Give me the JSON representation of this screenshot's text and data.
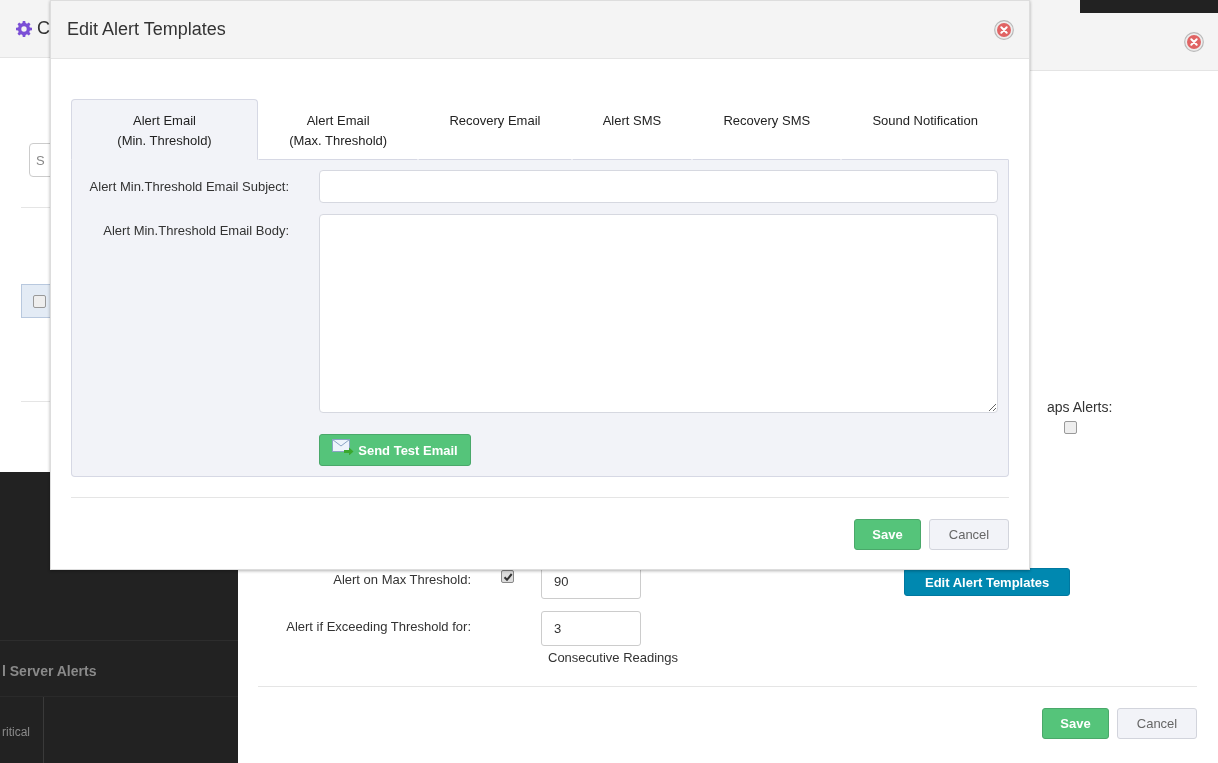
{
  "back_window": {
    "title": "C",
    "search": {
      "placeholder": "S"
    },
    "row": {
      "checked": false
    }
  },
  "back_page": {
    "heading": "l Server Alerts",
    "column_1": "ritical"
  },
  "settings_dialog": {
    "section": {
      "label": "aps Alerts:",
      "checked": false
    },
    "fields": [
      {
        "kind": "check-input",
        "label": "Alert on Max Threshold:",
        "checked": true,
        "value": "90"
      },
      {
        "kind": "input",
        "label": "Alert if Exceeding Threshold for:",
        "value": "3",
        "note": "Consecutive Readings"
      }
    ],
    "templates_button": "Edit Alert Templates",
    "buttons": [
      {
        "kind": "primary",
        "label": "Save"
      },
      {
        "kind": "secondary",
        "label": "Cancel"
      }
    ]
  },
  "template_dialog": {
    "title": "Edit Alert Templates",
    "tabs": [
      {
        "label": "Alert Email\n(Min. Threshold)",
        "selected": true
      },
      {
        "label": "Alert Email\n(Max. Threshold)",
        "selected": false
      },
      {
        "label": "Recovery Email",
        "selected": false
      },
      {
        "label": "Alert SMS",
        "selected": false
      },
      {
        "label": "Recovery SMS",
        "selected": false
      },
      {
        "label": "Sound Notification",
        "selected": false
      }
    ],
    "subject_label": "Alert Min.Threshold Email Subject:",
    "body_label": "Alert Min.Threshold Email Body:",
    "test_button": "Send Test Email",
    "buttons": [
      {
        "kind": "primary",
        "label": "Save"
      },
      {
        "kind": "secondary",
        "label": "Cancel"
      }
    ]
  }
}
